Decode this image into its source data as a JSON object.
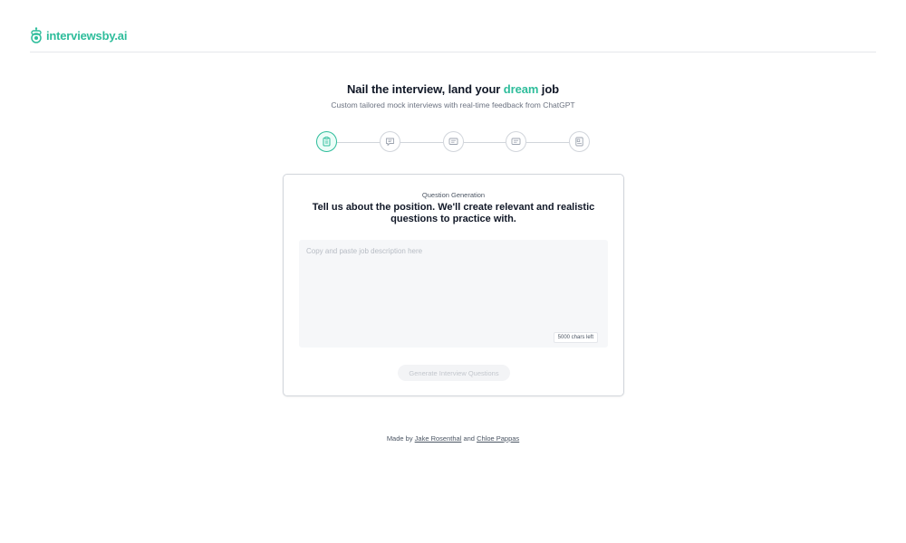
{
  "brand": {
    "name": "interviewsby.ai",
    "icon": "robot-icon",
    "color": "#2ebd9b"
  },
  "hero": {
    "title_before": "Nail the interview, land your ",
    "title_accent": "dream",
    "title_after": " job",
    "subtitle": "Custom tailored mock interviews with real-time feedback from ChatGPT"
  },
  "steps": [
    {
      "icon": "clipboard-icon",
      "active": true
    },
    {
      "icon": "chat-icon",
      "active": false
    },
    {
      "icon": "message-icon",
      "active": false
    },
    {
      "icon": "message-icon",
      "active": false
    },
    {
      "icon": "document-icon",
      "active": false
    }
  ],
  "card": {
    "label": "Question Generation",
    "heading": "Tell us about the position. We'll create relevant and realistic questions to practice with.",
    "input_placeholder": "Copy and paste job description here",
    "input_value": "",
    "chars_left": "5000 chars left",
    "button_label": "Generate Interview Questions"
  },
  "footer": {
    "made_by": "Made by ",
    "author1": "Jake Rosenthal",
    "and": " and ",
    "author2": "Chloe Pappas"
  }
}
